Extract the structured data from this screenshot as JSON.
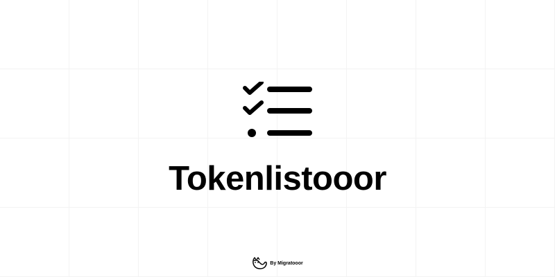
{
  "app": {
    "title": "Tokenlistooor",
    "logo_icon": "checklist-icon"
  },
  "footer": {
    "label": "By Migratooor",
    "icon": "cat-icon"
  },
  "colors": {
    "background": "#ffffff",
    "foreground": "#000000",
    "grid": "#f3f3f3"
  }
}
